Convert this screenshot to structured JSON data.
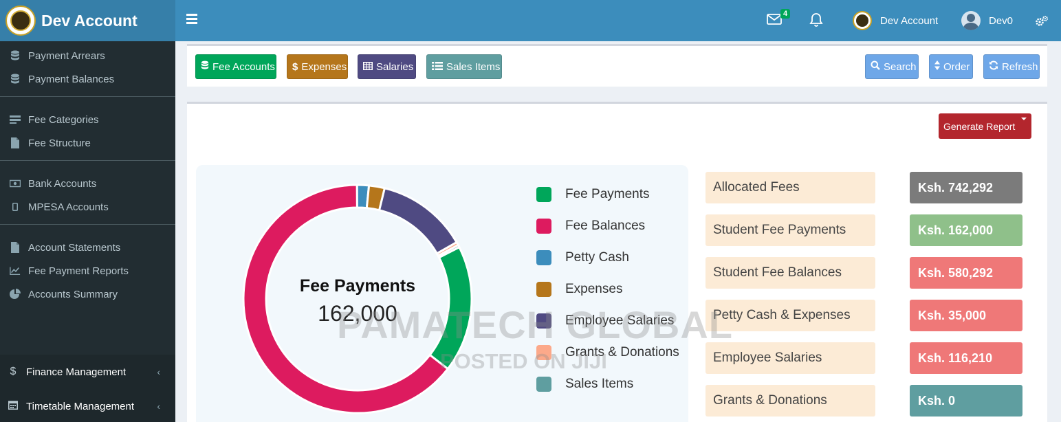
{
  "app": {
    "brand": "Dev Account"
  },
  "sidebar": {
    "groups": [
      {
        "items": [
          {
            "label": "Payment Arrears",
            "icon": "database-icon"
          },
          {
            "label": "Payment Balances",
            "icon": "database-icon"
          }
        ]
      },
      {
        "items": [
          {
            "label": "Fee Categories",
            "icon": "list-icon"
          },
          {
            "label": "Fee Structure",
            "icon": "file-icon"
          }
        ]
      },
      {
        "items": [
          {
            "label": "Bank Accounts",
            "icon": "money-bill-icon"
          },
          {
            "label": "MPESA Accounts",
            "icon": "mobile-icon"
          }
        ]
      },
      {
        "items": [
          {
            "label": "Account Statements",
            "icon": "file-icon"
          },
          {
            "label": "Fee Payment Reports",
            "icon": "line-chart-icon"
          },
          {
            "label": "Accounts Summary",
            "icon": "pie-chart-icon"
          }
        ]
      }
    ],
    "sections": [
      {
        "label": "Finance Management",
        "icon": "dollar-icon"
      },
      {
        "label": "Timetable Management",
        "icon": "calendar-icon"
      }
    ]
  },
  "topbar": {
    "mail_count": "4",
    "account_name": "Dev Account",
    "user_name": "Dev0"
  },
  "toolbar": {
    "fee_accounts": "Fee Accounts",
    "expenses": "Expenses",
    "salaries": "Salaries",
    "sales_items": "Sales Items",
    "search": "Search",
    "order": "Order",
    "refresh": "Refresh"
  },
  "main": {
    "generate_report": "Generate Report"
  },
  "chart_data": {
    "type": "pie",
    "center_title": "Fee Payments",
    "center_value": "162,000",
    "legend_placement": "right",
    "categories": [
      "Fee Payments",
      "Fee Balances",
      "Petty Cash",
      "Expenses",
      "Employee Salaries",
      "Grants & Donations",
      "Sales Items"
    ],
    "values": [
      162000,
      580292,
      15000,
      20000,
      116210,
      4000,
      3000
    ],
    "colors": [
      "#00a65a",
      "#dd1b5f",
      "#3c8dbc",
      "#b5761b",
      "#4f4a82",
      "#fca98a",
      "#5f9ea0"
    ]
  },
  "stats": [
    {
      "label": "Allocated Fees",
      "value": "Ksh. 742,292",
      "color": "#7b7b7b"
    },
    {
      "label": "Student Fee Payments",
      "value": "Ksh. 162,000",
      "color": "#8fc08a"
    },
    {
      "label": "Student Fee Balances",
      "value": "Ksh. 580,292",
      "color": "#ef7878"
    },
    {
      "label": "Petty Cash & Expenses",
      "value": "Ksh. 35,000",
      "color": "#ef7878"
    },
    {
      "label": "Employee Salaries",
      "value": "Ksh. 116,210",
      "color": "#ef7878"
    },
    {
      "label": "Grants & Donations",
      "value": "Ksh. 0",
      "color": "#5f9ea0"
    }
  ],
  "watermark": {
    "line1": "PAMATECH GLOBAL",
    "line2": "POSTED ON JIJI"
  }
}
